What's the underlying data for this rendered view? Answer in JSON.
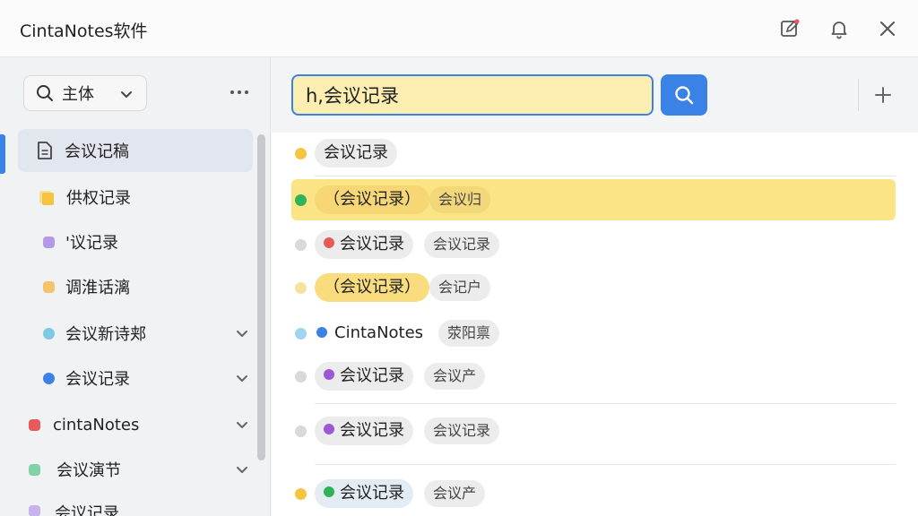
{
  "app": {
    "title": "CintaNotes软件"
  },
  "sidebar": {
    "scope_label": "主体",
    "items": [
      {
        "label": "会议记稿",
        "color": "#3b82e6"
      },
      {
        "label": "供权记录",
        "color": "#f5c542"
      },
      {
        "label": "'议记录",
        "color": "#b49ae6"
      },
      {
        "label": "调淮话漓",
        "color": "#f5c46a"
      },
      {
        "label": "会议新诗郏",
        "color": "#7fc9e6"
      },
      {
        "label": "会议记录",
        "color": "#3b82e6"
      },
      {
        "label": "cintaNotes",
        "color": "#e85a5a"
      },
      {
        "label": "会议演节",
        "color": "#7fd3a6"
      },
      {
        "label": "会议记录",
        "color": "#c9b3ec"
      }
    ]
  },
  "search": {
    "value": "h,会议记录"
  },
  "notes": [
    {
      "bullet": "#f5c542",
      "title": "会议记录",
      "title_dot": "",
      "tag": ""
    },
    {
      "bullet": "#2fb355",
      "title": "（会议记录）",
      "title_dot": "",
      "tag": "会议归"
    },
    {
      "bullet": "#d9d9d9",
      "title": "会议记录",
      "title_dot": "#e85a5a",
      "tag": "会议记录"
    },
    {
      "bullet": "#f6e2a0",
      "title": "（会议记录）",
      "title_dot": "",
      "tag": "会记户"
    },
    {
      "bullet": "#9fd5ef",
      "title": "CintaNotes",
      "title_dot": "#3b82e6",
      "tag": "荥阳禀"
    },
    {
      "bullet": "#d9d9d9",
      "title": "会议记录",
      "title_dot": "#9b59d6",
      "tag": "会议产"
    },
    {
      "bullet": "#d9d9d9",
      "title": "会议记录",
      "title_dot": "#9b59d6",
      "tag": "会议记录"
    },
    {
      "bullet": "#f5c542",
      "title": "会议记录",
      "title_dot": "#2fb355",
      "tag": "会议产"
    }
  ]
}
